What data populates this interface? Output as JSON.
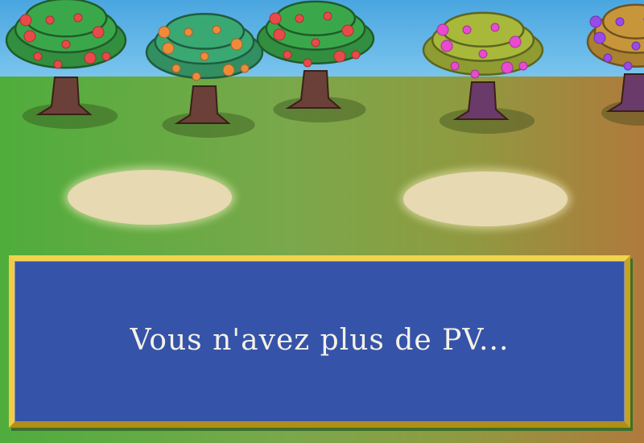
{
  "scene": {
    "sky_color": "#5cb6e8",
    "ground_left_color": "#4fad3c",
    "ground_right_color": "#b07a3c",
    "trees": [
      {
        "name": "tree-red-fruit-1",
        "foliage": "#3aa84a",
        "fruit": "#e84a4a"
      },
      {
        "name": "tree-orange-fruit",
        "foliage": "#3aa872",
        "fruit": "#f08a3a"
      },
      {
        "name": "tree-red-fruit-2",
        "foliage": "#3aa84a",
        "fruit": "#e84a4a"
      },
      {
        "name": "tree-pink-fruit",
        "foliage": "#a8b83a",
        "fruit": "#e84ad0"
      },
      {
        "name": "tree-purple-fruit",
        "foliage": "#c8963a",
        "fruit": "#9a4ae8"
      }
    ]
  },
  "dialog": {
    "message": "Vous n'avez plus de PV..."
  }
}
